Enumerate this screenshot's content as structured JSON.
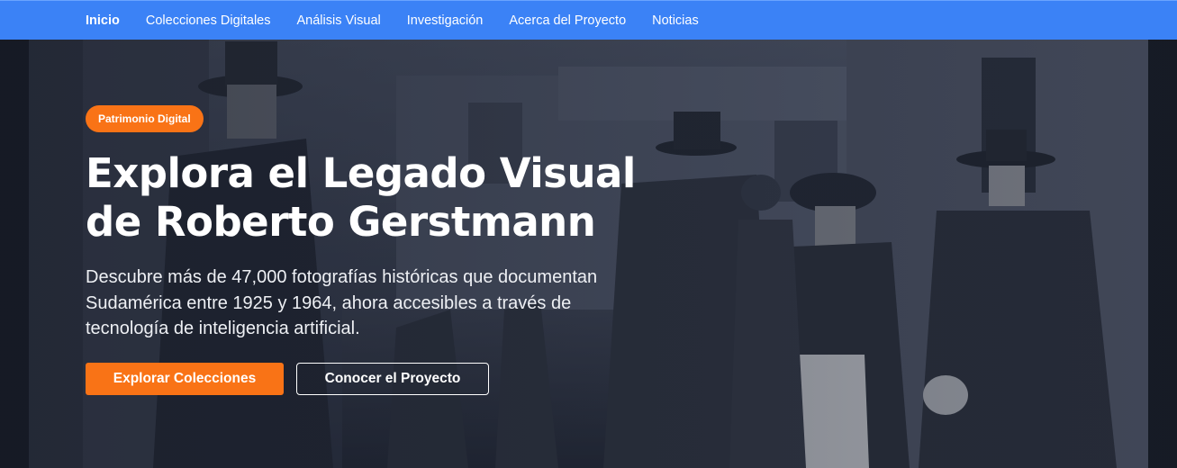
{
  "nav": {
    "items": [
      {
        "label": "Inicio",
        "active": true
      },
      {
        "label": "Colecciones Digitales",
        "active": false
      },
      {
        "label": "Análisis Visual",
        "active": false
      },
      {
        "label": "Investigación",
        "active": false
      },
      {
        "label": "Acerca del Proyecto",
        "active": false
      },
      {
        "label": "Noticias",
        "active": false
      }
    ]
  },
  "hero": {
    "badge": "Patrimonio Digital",
    "title_line1": "Explora el Legado Visual",
    "title_line2": "de Roberto Gerstmann",
    "description_line1": "Descubre más de 47,000 fotografías históricas que documentan",
    "description_line2": "Sudamérica entre 1925 y 1964, ahora accesibles a través de",
    "description_line3": "tecnología de inteligencia artificial.",
    "primary_button": "Explorar Colecciones",
    "secondary_button": "Conocer el Proyecto",
    "background_image": "historic-street-photo"
  },
  "colors": {
    "nav_background": "#3b82f6",
    "accent": "#f97316",
    "text": "#ffffff"
  }
}
